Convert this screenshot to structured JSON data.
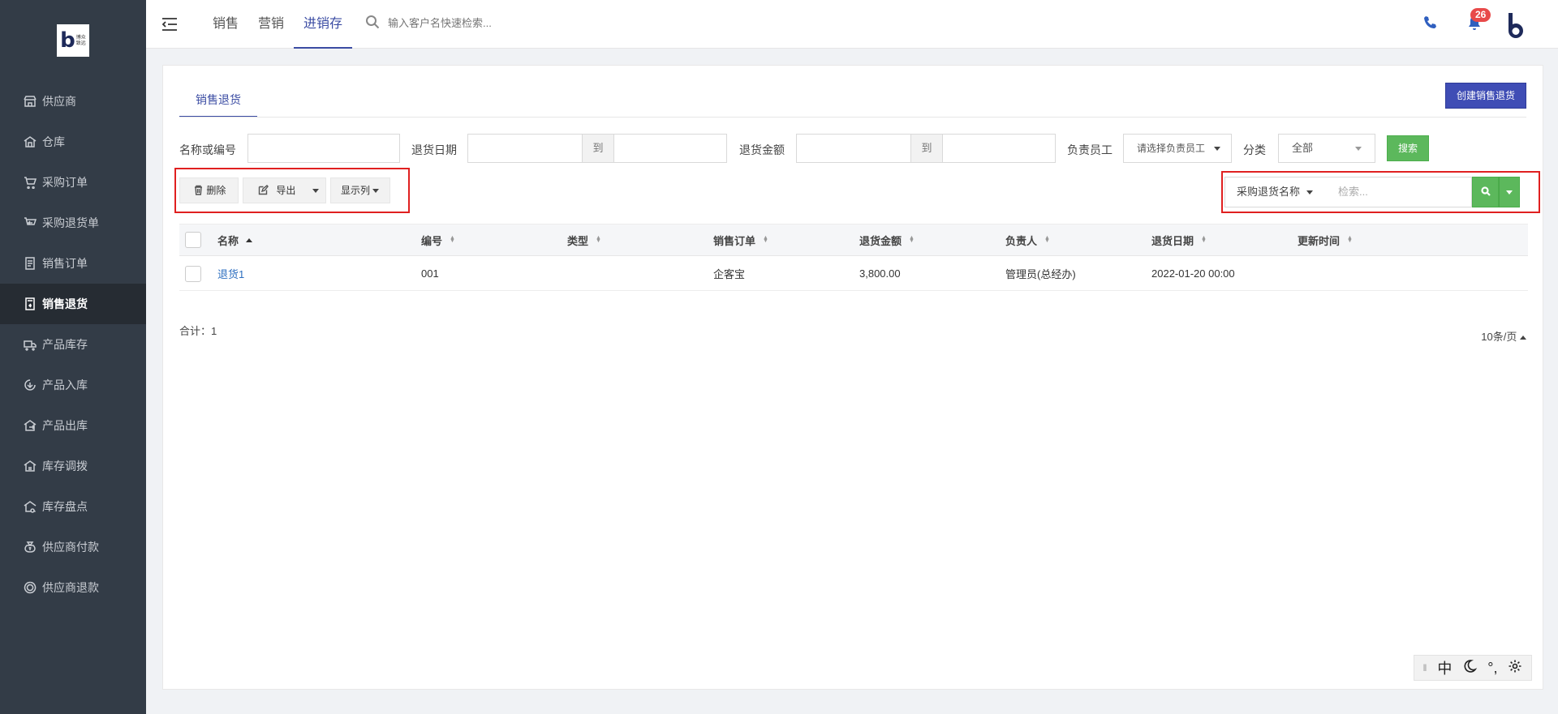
{
  "logo": {
    "mark": "b",
    "text_line1": "博众",
    "text_line2": "致远"
  },
  "sidebar": {
    "items": [
      {
        "label": "供应商",
        "icon": "store-icon"
      },
      {
        "label": "仓库",
        "icon": "warehouse-icon"
      },
      {
        "label": "采购订单",
        "icon": "cart-icon"
      },
      {
        "label": "采购退货单",
        "icon": "cart-return-icon"
      },
      {
        "label": "销售订单",
        "icon": "list-icon"
      },
      {
        "label": "销售退货",
        "icon": "return-doc-icon",
        "active": true
      },
      {
        "label": "产品库存",
        "icon": "truck-icon"
      },
      {
        "label": "产品入库",
        "icon": "inbound-icon"
      },
      {
        "label": "产品出库",
        "icon": "outbound-icon"
      },
      {
        "label": "库存调拨",
        "icon": "transfer-icon"
      },
      {
        "label": "库存盘点",
        "icon": "inventory-check-icon"
      },
      {
        "label": "供应商付款",
        "icon": "money-bag-icon"
      },
      {
        "label": "供应商退款",
        "icon": "refund-icon"
      }
    ]
  },
  "topbar": {
    "tabs": [
      "销售",
      "营销",
      "进销存"
    ],
    "active_tab": "进销存",
    "search_placeholder": "输入客户名快速检索...",
    "notification_count": "26"
  },
  "panel": {
    "tab_label": "销售退货",
    "create_button": "创建销售退货"
  },
  "filters": {
    "name_label": "名称或编号",
    "date_label": "退货日期",
    "to_label": "到",
    "amount_label": "退货金额",
    "staff_label": "负责员工",
    "staff_placeholder": "请选择负责员工",
    "category_label": "分类",
    "category_value": "全部",
    "search_button": "搜索"
  },
  "toolbar": {
    "delete_label": "删除",
    "export_label": "导出",
    "columns_label": "显示列"
  },
  "quick_search": {
    "field_select": "采购退货名称",
    "placeholder": "检索..."
  },
  "table": {
    "columns": [
      "名称",
      "编号",
      "类型",
      "销售订单",
      "退货金额",
      "负责人",
      "退货日期",
      "更新时间"
    ],
    "rows": [
      {
        "name": "退货1",
        "code": "001",
        "type": "",
        "sales_order": "企客宝",
        "amount": "3,800.00",
        "owner": "管理员(总经办)",
        "date": "2022-01-20 00:00",
        "updated": ""
      }
    ]
  },
  "footer": {
    "total": "合计：1",
    "page_size": "10条/页"
  },
  "ime": {
    "lang": "中",
    "punct": "°,"
  },
  "colors": {
    "sidebar_bg": "#333c47",
    "accent": "#3b4ca3",
    "success": "#5cb85c",
    "highlight_border": "#e02020"
  }
}
